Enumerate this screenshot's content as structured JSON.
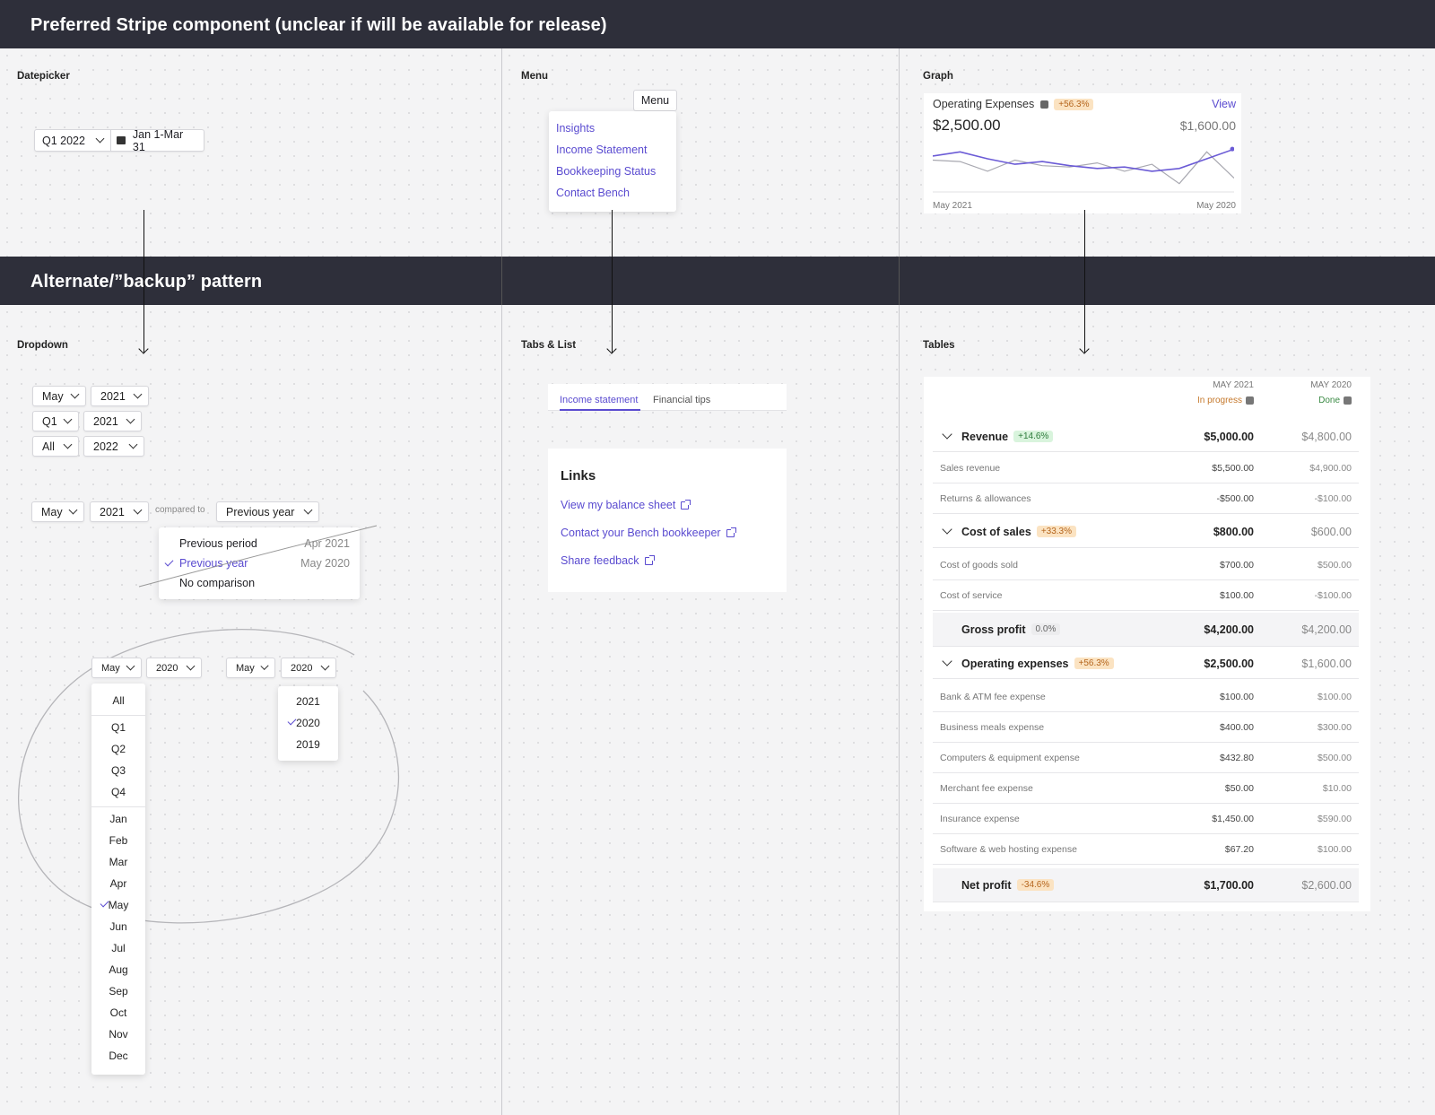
{
  "header": {
    "preferred_title": "Preferred Stripe component (unclear if will be available for release)",
    "alternate_title": "Alternate/”backup” pattern"
  },
  "datepicker": {
    "label": "Datepicker",
    "quarter": "Q1 2022",
    "range": "Jan 1-Mar 31"
  },
  "menu": {
    "label": "Menu",
    "button": "Menu",
    "items": [
      "Insights",
      "Income Statement",
      "Bookkeeping Status",
      "Contact Bench"
    ]
  },
  "graph": {
    "label": "Graph",
    "title": "Operating Expenses",
    "badge": "+56.3%",
    "view": "View",
    "value": "$2,500.00",
    "compare_value": "$1,600.00",
    "x_start": "May 2021",
    "x_end": "May 2020"
  },
  "chart_data": {
    "type": "line",
    "x": [
      1,
      2,
      3,
      4,
      5,
      6,
      7,
      8,
      9,
      10,
      11,
      12
    ],
    "series": [
      {
        "values": [
          52,
          58,
          48,
          40,
          44,
          38,
          34,
          36,
          30,
          34,
          48,
          62
        ]
      },
      {
        "values": [
          46,
          44,
          30,
          46,
          38,
          36,
          42,
          30,
          40,
          12,
          58,
          20
        ]
      }
    ],
    "colors": [
      "#6b5bd6",
      "#a8a8b0"
    ]
  },
  "dropdown": {
    "label": "Dropdown",
    "rows": [
      {
        "month": "May",
        "year": "2021"
      },
      {
        "month": "Q1",
        "year": "2021"
      },
      {
        "month": "All",
        "year": "2022"
      }
    ],
    "compare_row": {
      "month": "May",
      "year": "2021",
      "compared_to": "compared to",
      "option": "Previous year"
    },
    "compare_options": [
      {
        "label": "Previous period",
        "value": "Apr 2021"
      },
      {
        "label": "Previous year",
        "value": "May 2020"
      },
      {
        "label": "No comparison",
        "value": ""
      }
    ],
    "left_select": {
      "month": "May",
      "year": "2020"
    },
    "right_select": {
      "month": "May",
      "year": "2020"
    },
    "period_list": {
      "all": "All",
      "quarters": [
        "Q1",
        "Q2",
        "Q3",
        "Q4"
      ],
      "months": [
        "Jan",
        "Feb",
        "Mar",
        "Apr",
        "May",
        "Jun",
        "Jul",
        "Aug",
        "Sep",
        "Oct",
        "Nov",
        "Dec"
      ]
    },
    "year_list": [
      "2021",
      "2020",
      "2019"
    ]
  },
  "tabs": {
    "label": "Tabs & List",
    "items": [
      "Income statement",
      "Financial tips"
    ],
    "links_title": "Links",
    "links": [
      "View my balance sheet",
      "Contact your Bench bookkeeper",
      "Share feedback"
    ]
  },
  "tables": {
    "label": "Tables",
    "col1": {
      "period": "MAY 2021",
      "status": "In progress"
    },
    "col2": {
      "period": "MAY 2020",
      "status": "Done"
    },
    "rows": [
      {
        "kind": "section",
        "label": "Revenue",
        "badge": "+14.6%",
        "badge_type": "green",
        "v1": "$5,000.00",
        "v2": "$4,800.00"
      },
      {
        "kind": "item",
        "label": "Sales revenue",
        "v1": "$5,500.00",
        "v2": "$4,900.00"
      },
      {
        "kind": "item",
        "label": "Returns & allowances",
        "v1": "-$500.00",
        "v2": "-$100.00"
      },
      {
        "kind": "section",
        "label": "Cost of sales",
        "badge": "+33.3%",
        "badge_type": "orange",
        "v1": "$800.00",
        "v2": "$600.00"
      },
      {
        "kind": "item",
        "label": "Cost of goods sold",
        "v1": "$700.00",
        "v2": "$500.00"
      },
      {
        "kind": "item",
        "label": "Cost of service",
        "v1": "$100.00",
        "v2": "-$100.00"
      },
      {
        "kind": "total",
        "label": "Gross profit",
        "badge": "0.0%",
        "badge_type": "gray",
        "v1": "$4,200.00",
        "v2": "$4,200.00"
      },
      {
        "kind": "section",
        "label": "Operating expenses",
        "badge": "+56.3%",
        "badge_type": "orange",
        "v1": "$2,500.00",
        "v2": "$1,600.00"
      },
      {
        "kind": "item",
        "label": "Bank & ATM fee expense",
        "v1": "$100.00",
        "v2": "$100.00"
      },
      {
        "kind": "item",
        "label": "Business meals expense",
        "v1": "$400.00",
        "v2": "$300.00"
      },
      {
        "kind": "item",
        "label": "Computers & equipment expense",
        "v1": "$432.80",
        "v2": "$500.00"
      },
      {
        "kind": "item",
        "label": "Merchant fee expense",
        "v1": "$50.00",
        "v2": "$10.00"
      },
      {
        "kind": "item",
        "label": "Insurance expense",
        "v1": "$1,450.00",
        "v2": "$590.00"
      },
      {
        "kind": "item",
        "label": "Software & web hosting expense",
        "v1": "$67.20",
        "v2": "$100.00"
      },
      {
        "kind": "total",
        "label": "Net profit",
        "badge": "-34.6%",
        "badge_type": "orange",
        "v1": "$1,700.00",
        "v2": "$2,600.00"
      }
    ]
  }
}
